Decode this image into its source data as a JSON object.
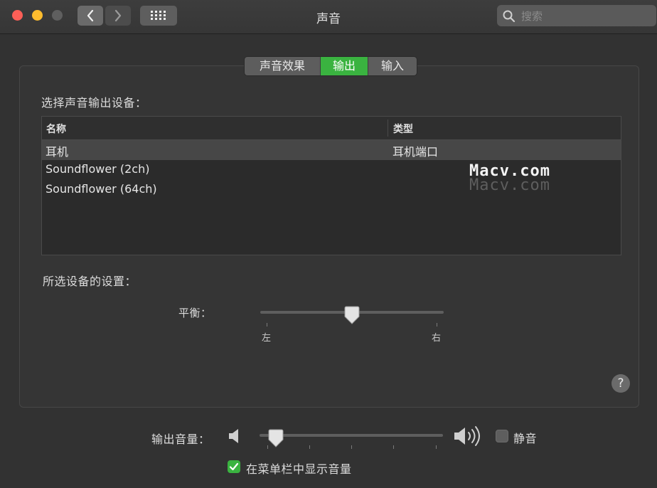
{
  "window": {
    "title": "声音"
  },
  "search": {
    "placeholder": "搜索"
  },
  "tabs": [
    {
      "label": "声音效果",
      "selected": false
    },
    {
      "label": "输出",
      "selected": true
    },
    {
      "label": "输入",
      "selected": false
    }
  ],
  "output": {
    "select_label": "选择声音输出设备：",
    "columns": {
      "name": "名称",
      "type": "类型"
    },
    "devices": [
      {
        "name": "耳机",
        "type": "耳机端口",
        "selected": true
      },
      {
        "name": "Soundflower (2ch)",
        "type": "",
        "selected": false
      },
      {
        "name": "Soundflower (64ch)",
        "type": "",
        "selected": false
      }
    ],
    "settings_label": "所选设备的设置：",
    "balance": {
      "label": "平衡：",
      "left": "左",
      "right": "右",
      "value": 0.5
    }
  },
  "help": {
    "label": "?"
  },
  "volume": {
    "label": "输出音量：",
    "value": 0.05,
    "mute_label": "静音",
    "mute_checked": false,
    "show_in_menubar_label": "在菜单栏中显示音量",
    "show_in_menubar_checked": true
  },
  "watermark": {
    "text": "Macv.com"
  },
  "colors": {
    "accent": "#3ab340",
    "close": "#fc5f57",
    "minimize": "#fdbc2e"
  }
}
